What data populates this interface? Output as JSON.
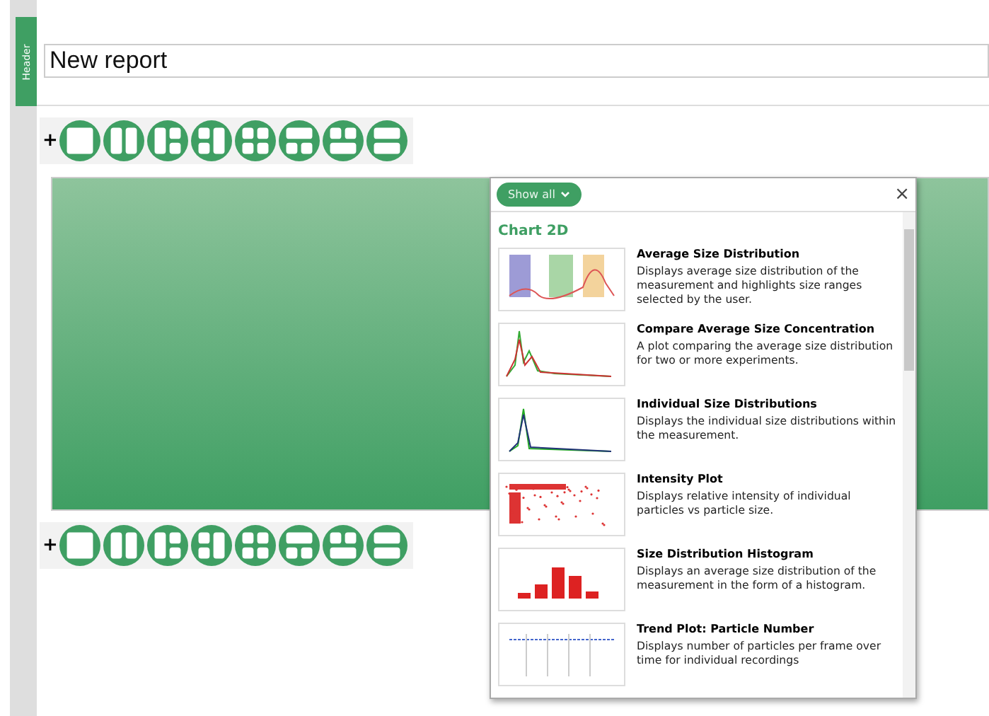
{
  "header_tab": {
    "label": "Header"
  },
  "title_field": {
    "value": "New report"
  },
  "layout_toolbars": [
    {
      "add": "+",
      "layouts": [
        {
          "kind": "full"
        },
        {
          "kind": "two-col"
        },
        {
          "kind": "left-right-split"
        },
        {
          "kind": "left-split-right"
        },
        {
          "kind": "grid"
        },
        {
          "kind": "top-bottom-split"
        },
        {
          "kind": "top-split-bottom"
        },
        {
          "kind": "two-row"
        }
      ]
    },
    {
      "add": "+",
      "layouts": [
        {
          "kind": "full"
        },
        {
          "kind": "two-col"
        },
        {
          "kind": "left-right-split"
        },
        {
          "kind": "left-split-right"
        },
        {
          "kind": "grid"
        },
        {
          "kind": "top-bottom-split"
        },
        {
          "kind": "top-split-bottom"
        },
        {
          "kind": "two-row"
        }
      ]
    }
  ],
  "chart_picker": {
    "filter": "Show all",
    "close": "×",
    "section": "Chart 2D",
    "items": [
      {
        "kind": "bands",
        "title": "Average Size Distribution",
        "description": "Displays average size distribution of the measurement and highlights size ranges selected by the user."
      },
      {
        "kind": "lines",
        "title": "Compare Average Size Concentration",
        "description": "A plot comparing the average size distribution for two or more experiments."
      },
      {
        "kind": "peaks",
        "title": "Individual Size Distributions",
        "description": "Displays the individual size distributions within the measurement."
      },
      {
        "kind": "scatter",
        "title": "Intensity Plot",
        "description": "Displays relative intensity of individual particles vs particle size."
      },
      {
        "kind": "histogram",
        "title": "Size Distribution Histogram",
        "description": "Displays an average size distribution of the measurement in the form of a histogram."
      },
      {
        "kind": "trend",
        "title": "Trend Plot: Particle Number",
        "description": "Displays number of particles per frame over time for individual recordings"
      }
    ]
  }
}
